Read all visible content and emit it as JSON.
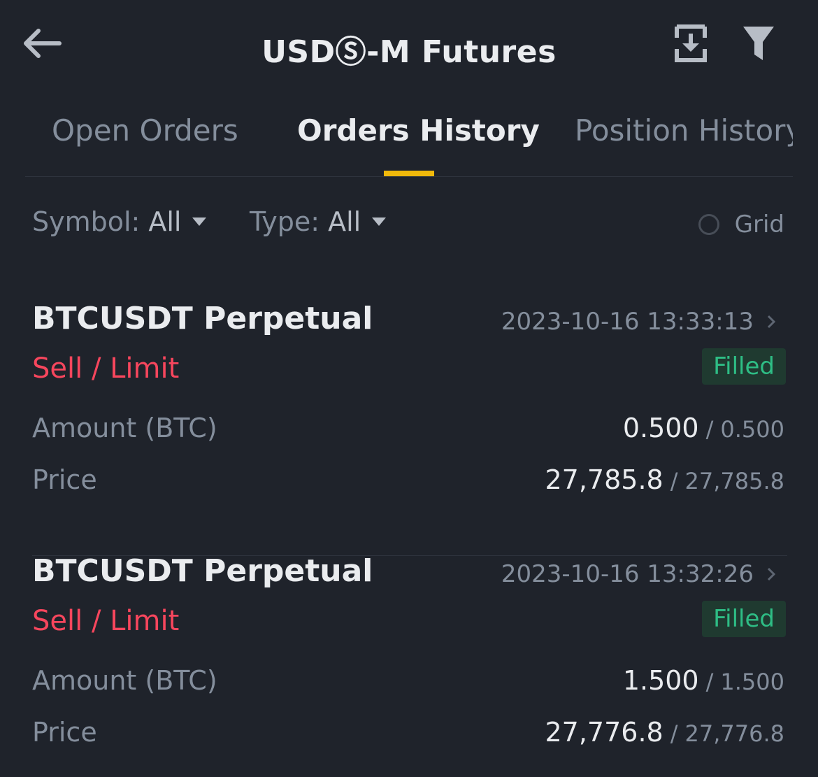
{
  "header": {
    "title": "USDⓈ-M Futures",
    "icons": [
      "back-arrow-icon",
      "export-icon",
      "filter-icon"
    ]
  },
  "tabs": [
    {
      "label": "Open Orders",
      "active": false
    },
    {
      "label": "Orders History",
      "active": true
    },
    {
      "label": "Position History",
      "active": false
    }
  ],
  "filters": {
    "symbol_label": "Symbol:",
    "symbol_value": "All",
    "type_label": "Type:",
    "type_value": "All",
    "grid_label": "Grid"
  },
  "orders": [
    {
      "symbol": "BTCUSDT Perpetual",
      "time": "2023-10-16 13:33:13",
      "side": "Sell / Limit",
      "status": "Filled",
      "amount_label": "Amount (BTC)",
      "amount_filled": "0.500",
      "amount_total": "0.500",
      "price_label": "Price",
      "price_avg": "27,785.8",
      "price_order": "27,785.8"
    },
    {
      "symbol": "BTCUSDT Perpetual",
      "time": "2023-10-16 13:32:26",
      "side": "Sell / Limit",
      "status": "Filled",
      "amount_label": "Amount (BTC)",
      "amount_filled": "1.500",
      "amount_total": "1.500",
      "price_label": "Price",
      "price_avg": "27,776.8",
      "price_order": "27,776.8"
    }
  ],
  "colors": {
    "background": "#1f232b",
    "accent": "#f0b90b",
    "sell": "#f6465d",
    "filled": "#2ebd85"
  }
}
